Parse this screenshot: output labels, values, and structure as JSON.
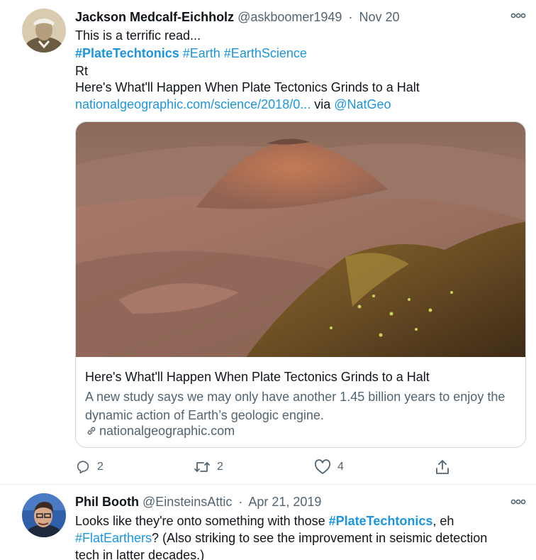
{
  "tweets": [
    {
      "author": "Jackson Medcalf-Eichholz",
      "handle": "@askboomer1949",
      "separator": "·",
      "time": "Nov 20",
      "text_line1": "This is a terrific read...",
      "hashtags": [
        "#PlateTechtonics",
        "#Earth",
        "#EarthScience"
      ],
      "text_line3": "Rt",
      "text_line4": "Here's What'll Happen When Plate Tectonics Grinds to a Halt",
      "link_url": "nationalgeographic.com/science/2018/0...",
      "via_text": "via",
      "via_handle": "@NatGeo",
      "card": {
        "title": "Here's What'll Happen When Plate Tectonics Grinds to a Halt",
        "description": "A new study says we may only have another 1.45 billion years to enjoy the dynamic action of Earth’s geologic engine.",
        "domain": "nationalgeographic.com"
      },
      "actions": {
        "replies": "2",
        "retweets": "2",
        "likes": "4"
      }
    },
    {
      "author": "Phil Booth",
      "handle": "@EinsteinsAttic",
      "separator": "·",
      "time": "Apr 21, 2019",
      "line1_prefix": "Looks like they're onto something with those ",
      "line1_hashtag": "#PlateTechtonics",
      "line1_suffix": ", eh",
      "line2_hashtag": "#FlatEarthers",
      "line2_suffix": "? (Also striking to see the improvement in seismic detection",
      "line3": "tech in latter decades.)"
    }
  ],
  "colors": {
    "accent": "#1b95e0",
    "secondary_text": "#536471",
    "border": "#cfd9de"
  },
  "icons": [
    "more-icon",
    "reply-icon",
    "retweet-icon",
    "like-icon",
    "share-icon",
    "link-icon"
  ]
}
